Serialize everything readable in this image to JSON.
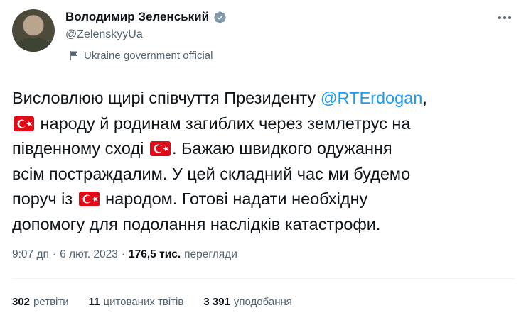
{
  "author": {
    "name": "Володимир Зеленський",
    "handle": "@ZelenskyyUa",
    "affiliation": "Ukraine government official",
    "avatar_icon": "avatar-photo",
    "verified_icon": "verified-badge-icon",
    "verified_color": "#829aab"
  },
  "tweet": {
    "lines": [
      {
        "before": "Висловлюю щирі співчуття Президенту ",
        "mention": "@RTErdogan",
        "after": ","
      },
      {
        "after": " народу й родинам загиблих через землетрус на"
      },
      {
        "before": "південному сході ",
        "after": ". Бажаю швидкого одужання"
      },
      {
        "before": "всім постраждалим. У цей складний час ми будемо"
      },
      {
        "before": "поруч із ",
        "after": " народом. Готові надати необхідну"
      },
      {
        "before": "допомогу для подолання наслідків катастрофи."
      }
    ],
    "flag_emoji": "turkey-flag",
    "mention_color": "#1d9bf0"
  },
  "meta": {
    "time": "9:07 дп",
    "separator": "·",
    "date": "6 лют. 2023",
    "separator2": "·",
    "views_number": "176,5",
    "views_unit": "тис.",
    "views_label": "перегляди"
  },
  "stats": [
    {
      "count": "302",
      "label": "ретвіти"
    },
    {
      "count": "11",
      "label": "цитованих твітів"
    },
    {
      "count": "3 391",
      "label": "уподобання"
    }
  ]
}
